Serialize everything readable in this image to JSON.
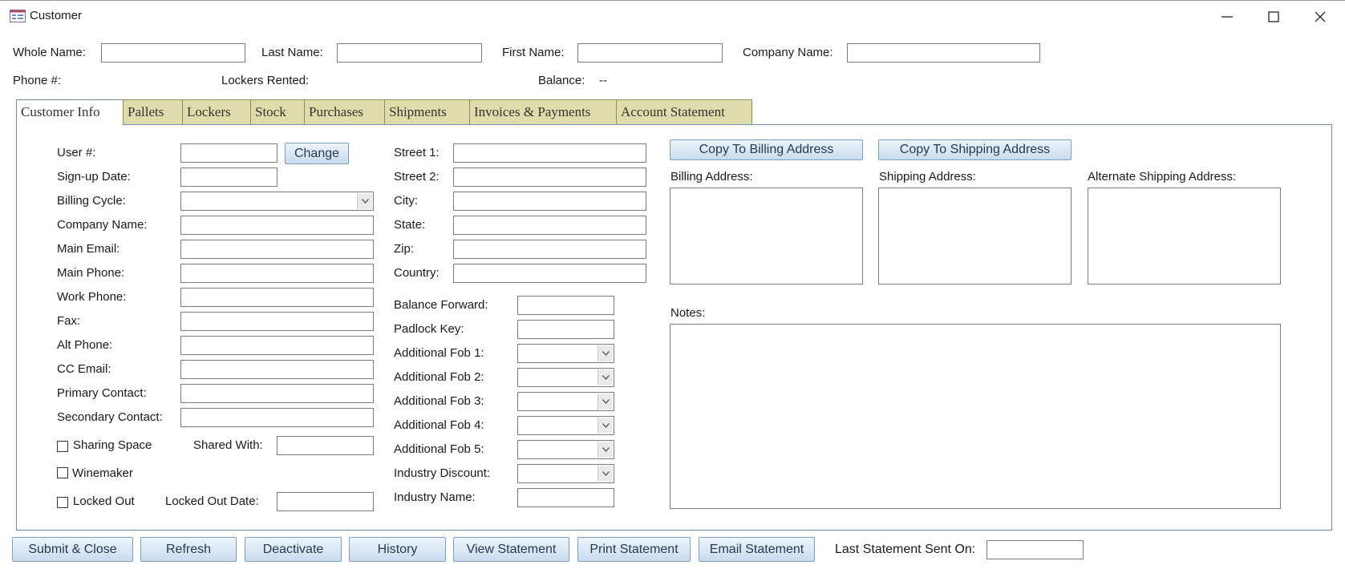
{
  "window": {
    "title": "Customer",
    "minimize_glyph": "—",
    "maximize_glyph": "☐",
    "close_glyph": "✕"
  },
  "header": {
    "whole_name_label": "Whole Name:",
    "whole_name_value": "",
    "last_name_label": "Last Name:",
    "last_name_value": "",
    "first_name_label": "First Name:",
    "first_name_value": "",
    "company_name_label": "Company Name:",
    "company_name_value": "",
    "phone_label": "Phone #:",
    "lockers_rented_label": "Lockers Rented:",
    "balance_label": "Balance:",
    "balance_value": "--"
  },
  "tabs": [
    {
      "label": "Customer Info",
      "active": true
    },
    {
      "label": "Pallets"
    },
    {
      "label": "Lockers"
    },
    {
      "label": "Stock"
    },
    {
      "label": "Purchases"
    },
    {
      "label": "Shipments"
    },
    {
      "label": "Invoices & Payments"
    },
    {
      "label": "Account Statement"
    }
  ],
  "customer_info": {
    "user_no_label": "User #:",
    "change_button": "Change",
    "signup_date_label": "Sign-up Date:",
    "billing_cycle_label": "Billing Cycle:",
    "company_name_label": "Company Name:",
    "main_email_label": "Main Email:",
    "main_phone_label": "Main Phone:",
    "work_phone_label": "Work Phone:",
    "fax_label": "Fax:",
    "alt_phone_label": "Alt Phone:",
    "cc_email_label": "CC Email:",
    "primary_contact_label": "Primary Contact:",
    "secondary_contact_label": "Secondary Contact:",
    "sharing_space_label": "Sharing Space",
    "shared_with_label": "Shared With:",
    "winemaker_label": "Winemaker",
    "locked_out_label": "Locked Out",
    "locked_out_date_label": "Locked Out Date:"
  },
  "address": {
    "street1_label": "Street 1:",
    "street2_label": "Street 2:",
    "city_label": "City:",
    "state_label": "State:",
    "zip_label": "Zip:",
    "country_label": "Country:"
  },
  "extra": {
    "balance_forward_label": "Balance Forward:",
    "padlock_key_label": "Padlock Key:",
    "fob1_label": "Additional Fob 1:",
    "fob2_label": "Additional Fob 2:",
    "fob3_label": "Additional Fob 3:",
    "fob4_label": "Additional Fob 4:",
    "fob5_label": "Additional Fob 5:",
    "industry_discount_label": "Industry Discount:",
    "industry_name_label": "Industry Name:"
  },
  "right_panel": {
    "copy_billing_button": "Copy To Billing Address",
    "copy_shipping_button": "Copy To Shipping Address",
    "billing_address_label": "Billing Address:",
    "shipping_address_label": "Shipping Address:",
    "alt_shipping_address_label": "Alternate Shipping Address:",
    "notes_label": "Notes:"
  },
  "footer": {
    "submit_close": "Submit & Close",
    "refresh": "Refresh",
    "deactivate": "Deactivate",
    "history": "History",
    "view_statement": "View Statement",
    "print_statement": "Print Statement",
    "email_statement": "Email Statement",
    "last_statement_label": "Last Statement Sent On:"
  },
  "colors": {
    "tab_inactive": "#dedcab",
    "panel_border": "#6b91b8",
    "button_text": "#243a55"
  }
}
